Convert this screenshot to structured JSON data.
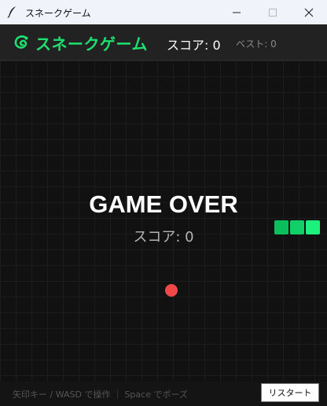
{
  "window": {
    "title": "スネークゲーム"
  },
  "header": {
    "title": "スネークゲーム",
    "score_label": "スコア: 0",
    "best_label": "ベスト: 0"
  },
  "board": {
    "game_over_title": "GAME OVER",
    "final_score_label": "スコア: 0",
    "snake_colors": [
      "#0bbf5c",
      "#12d068",
      "#1ef07d"
    ],
    "food_color": "#f04848"
  },
  "footer": {
    "help_text": "矢印キー / WASD で操作 ｜ Space でポーズ",
    "restart_label": "リスタート"
  },
  "icons": {
    "app": "feather-icon",
    "logo": "snake-icon",
    "minimize": "minimize-icon",
    "maximize": "maximize-icon",
    "close": "close-icon"
  }
}
